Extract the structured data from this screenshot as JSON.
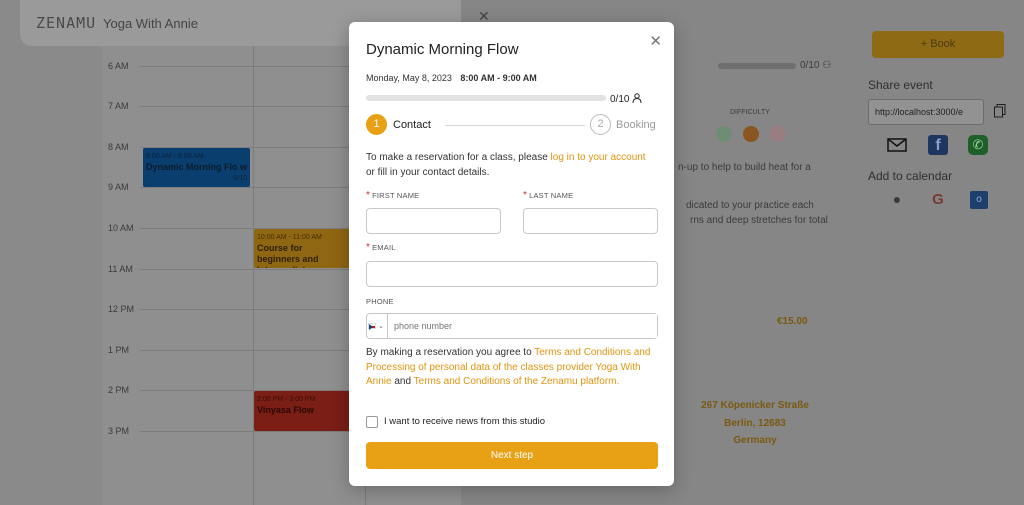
{
  "header": {
    "logo": "ZENAMU",
    "studio": "Yoga With Annie"
  },
  "calendar": {
    "hours": [
      "6 AM",
      "7 AM",
      "8 AM",
      "9 AM",
      "10 AM",
      "11 AM",
      "12 PM",
      "1 PM",
      "2 PM",
      "3 PM"
    ],
    "events": [
      {
        "time": "8:00 AM - 9:00 AM",
        "name": "Dynamic Morning Flo w",
        "count": "0/10",
        "color": "#0a3e6e"
      },
      {
        "time": "10:00 AM - 11:00 AM",
        "name": "Course for beginners and Intermediate ...",
        "color": "#8f6612"
      },
      {
        "time": "2:00 PM - 3:00 PM",
        "name": "Vinyasa Flow",
        "color": "#7a1e16"
      }
    ]
  },
  "detail": {
    "capacity": "0/10",
    "difficulty_label": "DIFFICULTY",
    "text1": "n-up to help to build heat for a",
    "text2": "dicated to your practice each",
    "text3": "rns and deep stretches for total",
    "price": "€15.00",
    "address": [
      "267 Köpenicker Straße",
      "Berlin, 12683",
      "Germany"
    ]
  },
  "sidebar": {
    "book_label": "+ Book",
    "share_title": "Share event",
    "share_url": "http://localhost:3000/e",
    "calendar_title": "Add to calendar"
  },
  "modal": {
    "title": "Dynamic Morning Flow",
    "date": "Monday, May 8, 2023",
    "time": "8:00 AM - 9:00 AM",
    "capacity": "0/10",
    "progress": 0,
    "steps": [
      {
        "num": "1",
        "label": "Contact"
      },
      {
        "num": "2",
        "label": "Booking"
      }
    ],
    "intro_pre": "To make a reservation for a class, please ",
    "intro_link": "log in to your account",
    "intro_post": " or fill in your contact details.",
    "first_name_label": "FIRST NAME",
    "last_name_label": "LAST NAME",
    "email_label": "EMAIL",
    "phone_label": "PHONE",
    "phone_placeholder": "phone number",
    "terms_pre": "By making a reservation you agree to ",
    "terms_link1": "Terms and Conditions and Processing of personal data of the classes provider Yoga With Annie",
    "terms_mid": " and ",
    "terms_link2": "Terms and Conditions of the Zenamu platform.",
    "newsletter_label": "I want to receive news from this studio",
    "next_label": "Next step",
    "accent": "#e8a115"
  }
}
